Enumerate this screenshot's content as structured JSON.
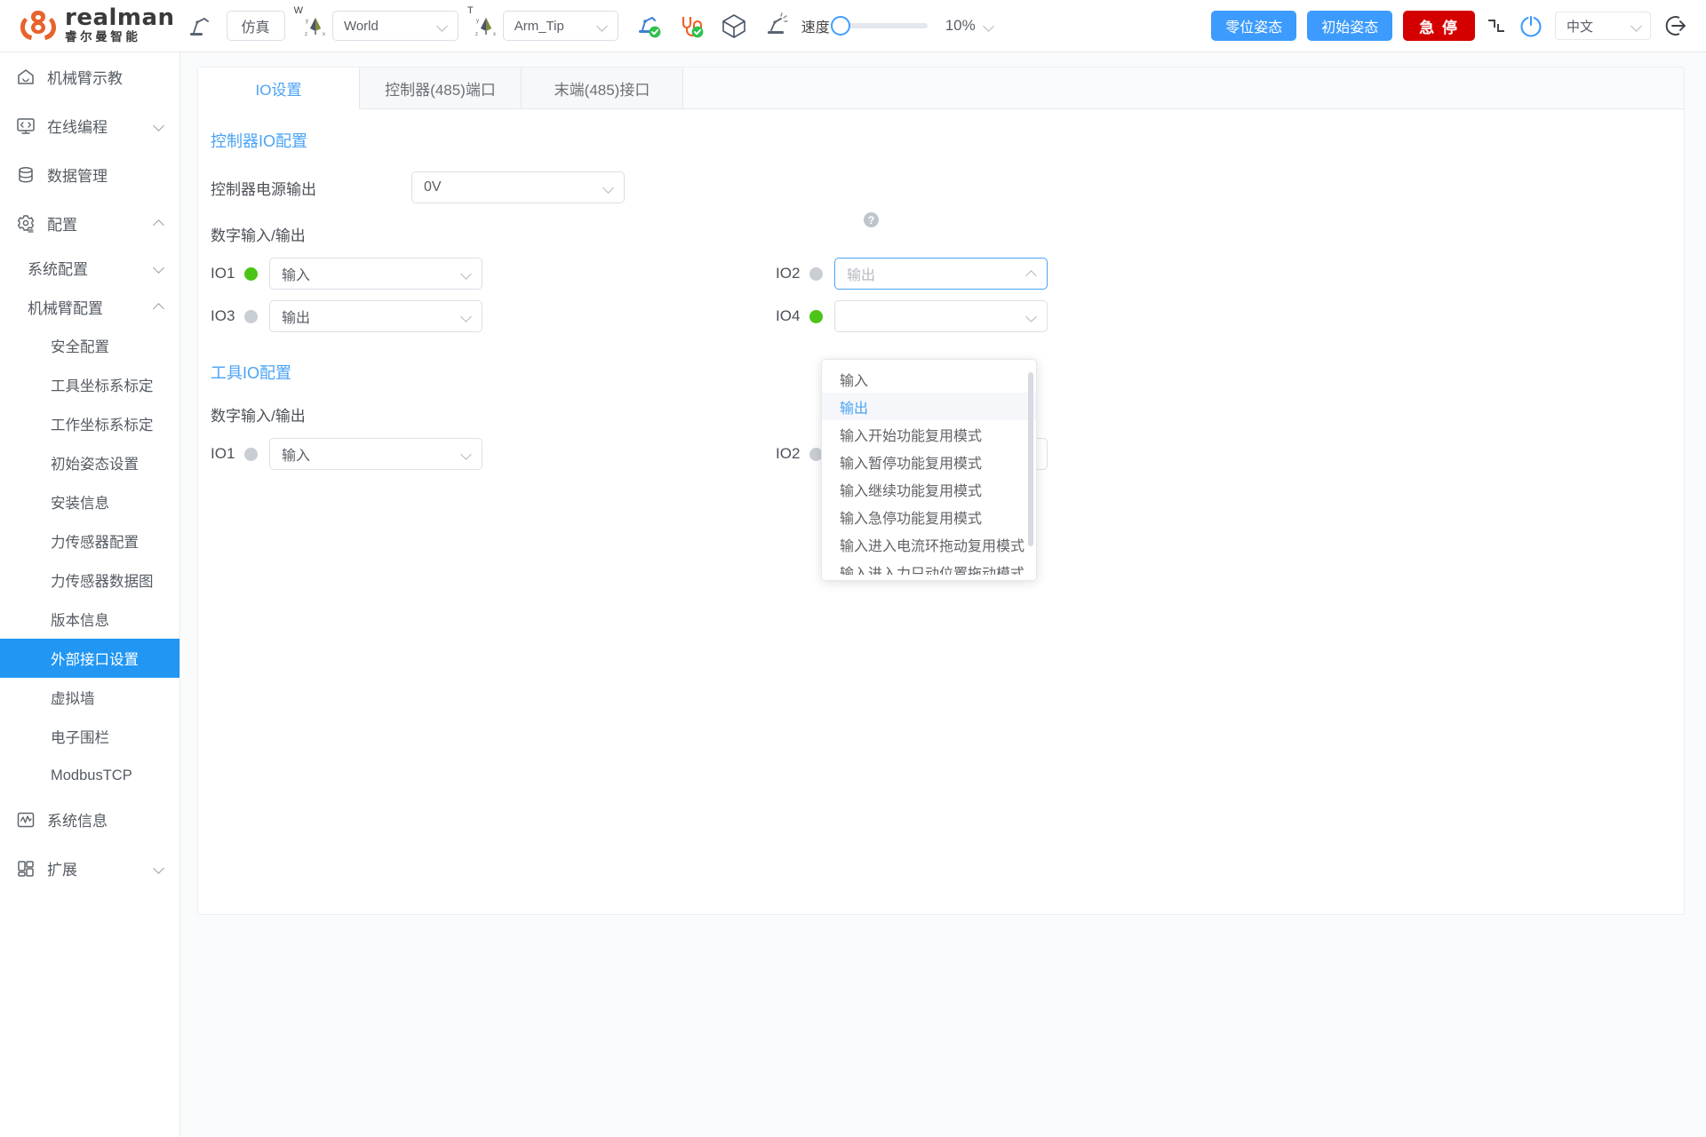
{
  "brand": {
    "name_en": "realman",
    "name_cn": "睿尔曼智能"
  },
  "toolbar": {
    "sim_button": "仿真",
    "coord_frame": {
      "axis_tag": "W",
      "value": "World"
    },
    "tool_frame": {
      "axis_tag": "T",
      "value": "Arm_Tip"
    },
    "speed_label": "速度",
    "speed_value": "10%",
    "zero_pose_button": "零位姿态",
    "init_pose_button": "初始姿态",
    "estop_button": "急 停",
    "language": "中文",
    "icons": [
      "teach-pendant-icon",
      "robot-connect-icon",
      "cable-connect-icon",
      "cube-icon",
      "collision-icon",
      "collapse-icon",
      "power-icon",
      "logout-icon"
    ]
  },
  "sidebar": {
    "items": [
      {
        "label": "机械臂示教",
        "icon": "home-icon",
        "type": "nav",
        "arrow": "none"
      },
      {
        "label": "在线编程",
        "icon": "code-icon",
        "type": "nav",
        "arrow": "down"
      },
      {
        "label": "数据管理",
        "icon": "database-icon",
        "type": "nav",
        "arrow": "none"
      },
      {
        "label": "配置",
        "icon": "gear-icon",
        "type": "nav",
        "arrow": "up"
      },
      {
        "label": "系统配置",
        "type": "sub",
        "arrow": "down"
      },
      {
        "label": "机械臂配置",
        "type": "sub",
        "arrow": "up"
      },
      {
        "label": "安全配置",
        "type": "leaf"
      },
      {
        "label": "工具坐标系标定",
        "type": "leaf"
      },
      {
        "label": "工作坐标系标定",
        "type": "leaf"
      },
      {
        "label": "初始姿态设置",
        "type": "leaf"
      },
      {
        "label": "安装信息",
        "type": "leaf"
      },
      {
        "label": "力传感器配置",
        "type": "leaf"
      },
      {
        "label": "力传感器数据图",
        "type": "leaf"
      },
      {
        "label": "版本信息",
        "type": "leaf"
      },
      {
        "label": "外部接口设置",
        "type": "leaf",
        "active": true
      },
      {
        "label": "虚拟墙",
        "type": "leaf"
      },
      {
        "label": "电子围栏",
        "type": "leaf"
      },
      {
        "label": "ModbusTCP",
        "type": "leaf"
      },
      {
        "label": "系统信息",
        "icon": "chart-icon",
        "type": "nav",
        "arrow": "none"
      },
      {
        "label": "扩展",
        "icon": "grid-icon",
        "type": "nav",
        "arrow": "down"
      }
    ]
  },
  "main": {
    "tabs": [
      {
        "label": "IO设置",
        "active": true
      },
      {
        "label": "控制器(485)端口",
        "active": false
      },
      {
        "label": "末端(485)接口",
        "active": false
      }
    ],
    "controller_section": {
      "title": "控制器IO配置",
      "power_output_label": "控制器电源输出",
      "power_output_value": "0V",
      "digital_io_label": "数字输入/输出",
      "help_icon": "?",
      "rows": [
        {
          "left": {
            "name": "IO1",
            "state": "on",
            "value": "输入"
          },
          "right": {
            "name": "IO2",
            "state": "off",
            "value": "输出",
            "open": true
          }
        },
        {
          "left": {
            "name": "IO3",
            "state": "off",
            "value": "输出"
          },
          "right": {
            "name": "IO4",
            "state": "on",
            "value": ""
          }
        }
      ]
    },
    "tool_section": {
      "title": "工具IO配置",
      "digital_io_label": "数字输入/输出",
      "rows": [
        {
          "left": {
            "name": "IO1",
            "state": "off",
            "value": "输入"
          },
          "right": {
            "name": "IO2",
            "state": "off",
            "value": ""
          }
        }
      ]
    },
    "dropdown": {
      "options": [
        "输入",
        "输出",
        "输入开始功能复用模式",
        "输入暂停功能复用模式",
        "输入继续功能复用模式",
        "输入急停功能复用模式",
        "输入进入电流环拖动复用模式",
        "输入进入力只动位置拖动模式"
      ],
      "selected_index": 1
    }
  },
  "colors": {
    "accent": "#4aa3f5",
    "primary_button": "#3c9bfc",
    "danger": "#d40000",
    "status_on": "#4cc417",
    "status_off": "#c9cdd4",
    "logo_orange": "#e8622c",
    "sidebar_active": "#2196f3"
  }
}
